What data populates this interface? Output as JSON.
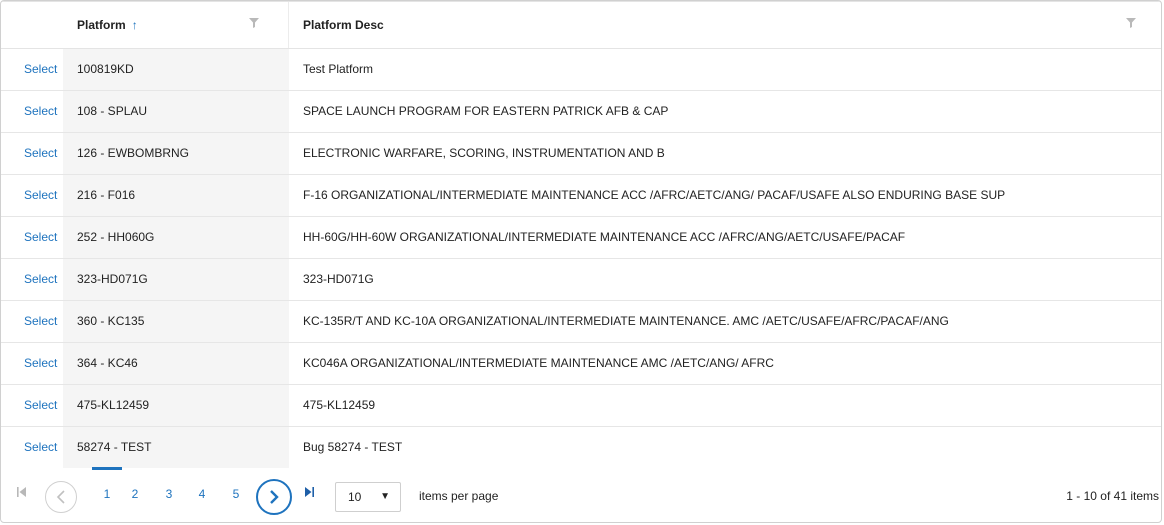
{
  "grid": {
    "columns": {
      "select": "",
      "platform": "Platform",
      "platform_sort_icon": "sort-ascending-icon",
      "platform_desc": "Platform Desc"
    },
    "filter_icon": "filter-icon",
    "select_label": "Select",
    "rows": [
      {
        "select": "Select",
        "platform": "100819KD",
        "desc": "Test Platform"
      },
      {
        "select": "Select",
        "platform": "108 - SPLAU",
        "desc": "SPACE LAUNCH PROGRAM FOR EASTERN PATRICK AFB & CAP"
      },
      {
        "select": "Select",
        "platform": "126 - EWBOMBRNG",
        "desc": "ELECTRONIC WARFARE, SCORING, INSTRUMENTATION AND B"
      },
      {
        "select": "Select",
        "platform": "216 - F016",
        "desc": "F-16 ORGANIZATIONAL/INTERMEDIATE MAINTENANCE ACC /AFRC/AETC/ANG/ PACAF/USAFE ALSO ENDURING BASE SUP"
      },
      {
        "select": "Select",
        "platform": "252 - HH060G",
        "desc": "HH-60G/HH-60W ORGANIZATIONAL/INTERMEDIATE MAINTENANCE ACC /AFRC/ANG/AETC/USAFE/PACAF"
      },
      {
        "select": "Select",
        "platform": "323-HD071G",
        "desc": "323-HD071G"
      },
      {
        "select": "Select",
        "platform": "360 - KC135",
        "desc": "KC-135R/T AND KC-10A ORGANIZATIONAL/INTERMEDIATE MAINTENANCE. AMC /AETC/USAFE/AFRC/PACAF/ANG"
      },
      {
        "select": "Select",
        "platform": "364 - KC46",
        "desc": "KC046A ORGANIZATIONAL/INTERMEDIATE MAINTENANCE AMC /AETC/ANG/ AFRC"
      },
      {
        "select": "Select",
        "platform": "475-KL12459",
        "desc": "475-KL12459"
      },
      {
        "select": "Select",
        "platform": "58274 - TEST",
        "desc": "Bug 58274 - TEST"
      }
    ]
  },
  "pager": {
    "first_icon": "first-page-icon",
    "prev_icon": "chevron-left-icon",
    "next_icon": "chevron-right-icon",
    "last_icon": "last-page-icon",
    "pages": [
      "1",
      "2",
      "3",
      "4",
      "5"
    ],
    "current_page": "1",
    "page_size": "10",
    "items_per_page_label": "items per page",
    "range_text": "1 - 10 of 41 items"
  },
  "colors": {
    "accent": "#1e73be",
    "border": "#e6e6e6",
    "sorted_column_bg": "#f5f5f5"
  }
}
